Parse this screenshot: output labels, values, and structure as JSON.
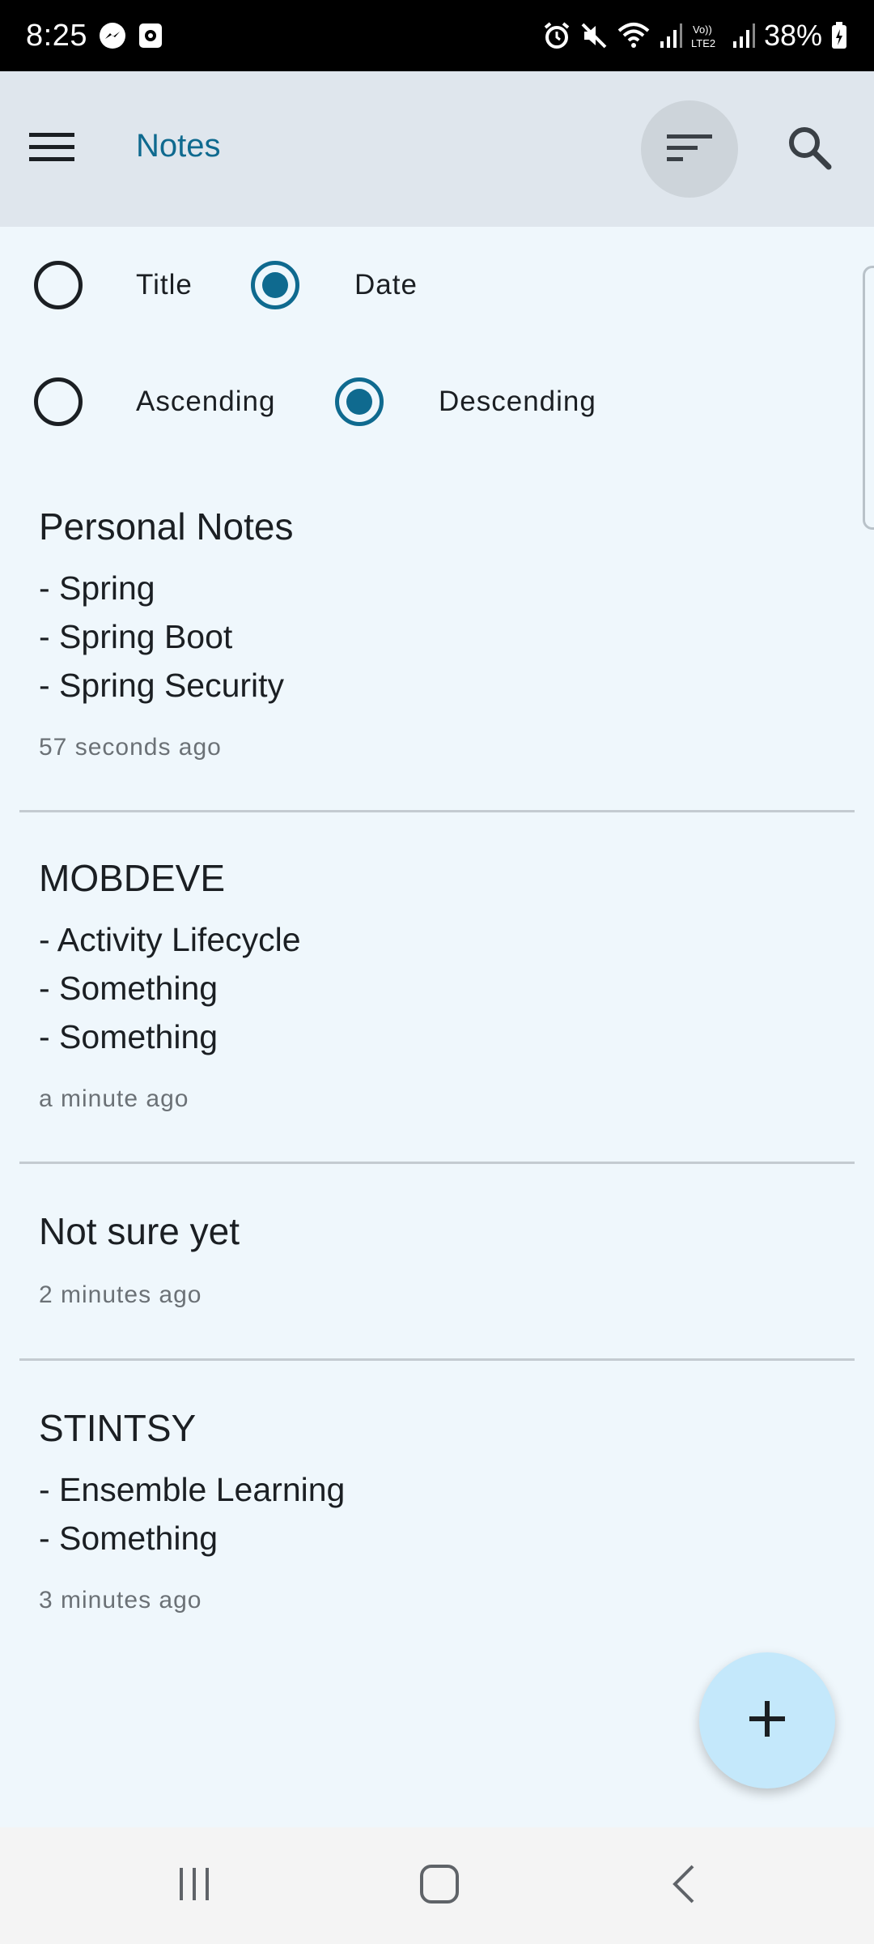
{
  "status_bar": {
    "time": "8:25",
    "battery": "38%",
    "icons": [
      "messenger-icon",
      "screen-record-icon",
      "alarm-icon",
      "mute-icon",
      "wifi-icon",
      "signal-icon",
      "volte-icon",
      "signal-icon",
      "battery-charging-icon"
    ]
  },
  "app_bar": {
    "title": "Notes",
    "menu_icon": "menu-icon",
    "sort_icon": "sort-icon",
    "search_icon": "search-icon"
  },
  "sort_options": {
    "sort_by": {
      "options": [
        {
          "label": "Title",
          "selected": false
        },
        {
          "label": "Date",
          "selected": true
        }
      ]
    },
    "order": {
      "options": [
        {
          "label": "Ascending",
          "selected": false
        },
        {
          "label": "Descending",
          "selected": true
        }
      ]
    }
  },
  "notes": [
    {
      "title": "Personal Notes",
      "lines": [
        "- Spring",
        "- Spring Boot",
        "- Spring Security"
      ],
      "time": "57 seconds ago"
    },
    {
      "title": "MOBDEVE",
      "lines": [
        "- Activity Lifecycle",
        "- Something",
        "- Something"
      ],
      "time": "a minute ago"
    },
    {
      "title": "Not sure yet",
      "lines": [],
      "time": "2 minutes ago"
    },
    {
      "title": "STINTSY",
      "lines": [
        "- Ensemble Learning",
        "- Something"
      ],
      "time": "3 minutes ago"
    }
  ],
  "fab": {
    "icon": "plus-icon"
  },
  "nav_bar": {
    "icons": [
      "recent-apps-icon",
      "home-icon",
      "back-icon"
    ]
  },
  "colors": {
    "accent": "#0f6a8f",
    "app_bar_bg": "#dfe6ed",
    "page_bg": "#eff7fc",
    "fab_bg": "#c4e8fb"
  }
}
